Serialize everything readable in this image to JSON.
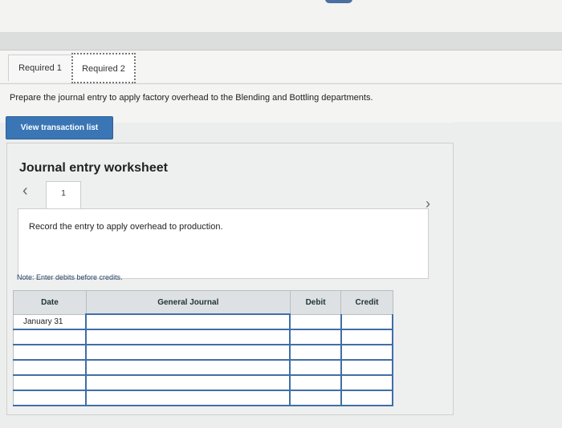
{
  "tabs": [
    {
      "label": "Required 1"
    },
    {
      "label": "Required 2"
    }
  ],
  "instruction": "Prepare the journal entry to apply factory overhead to the Blending and Bottling departments.",
  "view_button_label": "View transaction list",
  "worksheet": {
    "title": "Journal entry worksheet",
    "entry_number": "1",
    "entry_text": "Record the entry to apply overhead to production.",
    "note": "Note: Enter debits before credits."
  },
  "table": {
    "headers": [
      "Date",
      "General Journal",
      "Debit",
      "Credit"
    ],
    "rows": [
      {
        "date": "January 31"
      },
      {
        "date": ""
      },
      {
        "date": ""
      },
      {
        "date": ""
      },
      {
        "date": ""
      },
      {
        "date": ""
      }
    ]
  },
  "icons": [
    "chevron-left-icon",
    "chevron-right-icon"
  ],
  "colors": {
    "accent": "#3a76b5",
    "table_header": "#dde1e4",
    "border_blue": "#3f6fa7"
  }
}
